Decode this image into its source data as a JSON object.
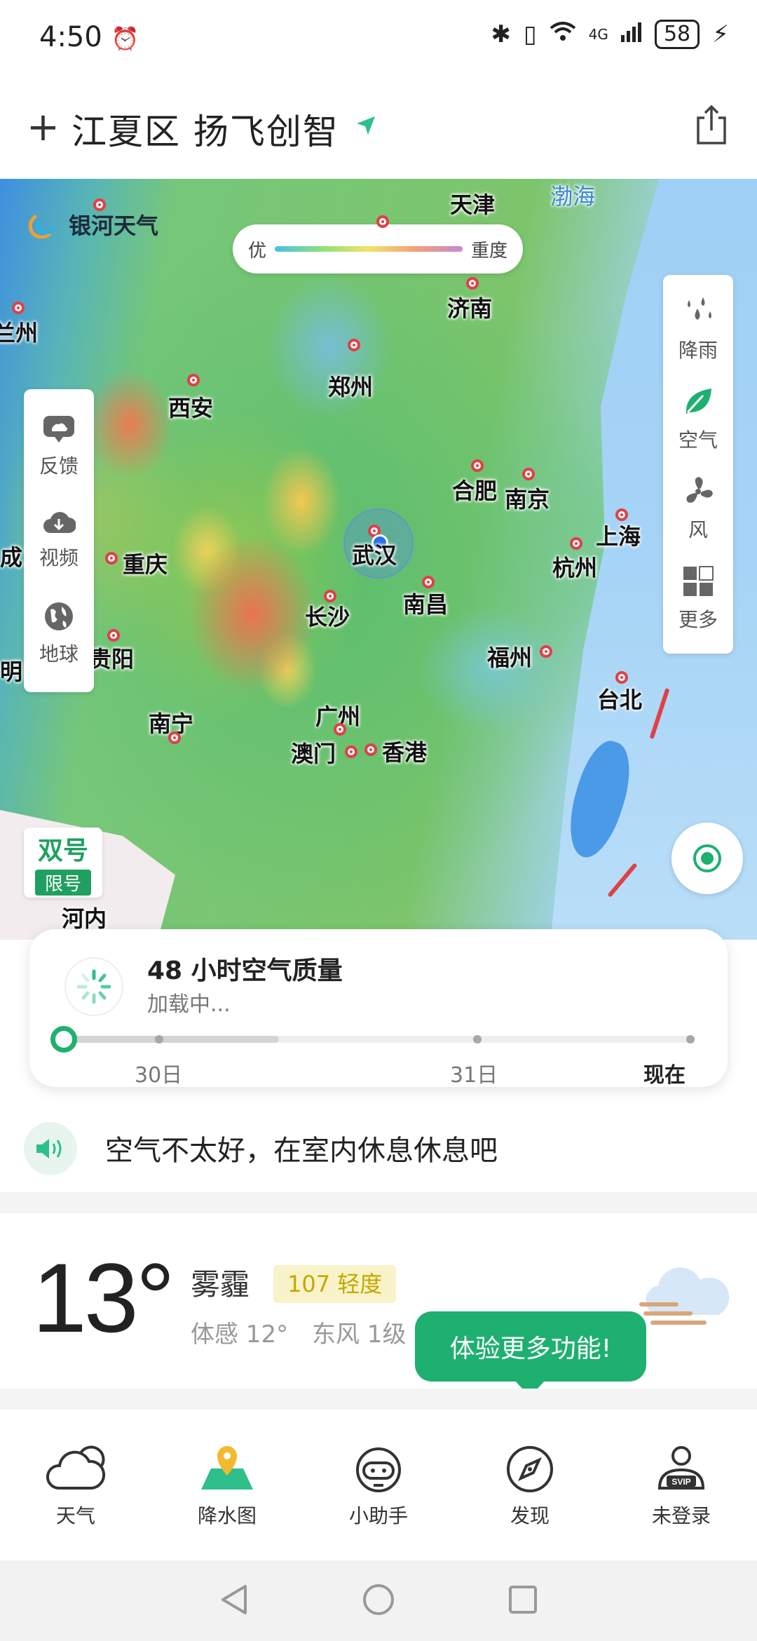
{
  "status_bar": {
    "time": "4:50",
    "network": "4G",
    "battery": "58"
  },
  "header": {
    "location": "江夏区 扬飞创智"
  },
  "map": {
    "brand": "银河天气",
    "legend": {
      "low": "优",
      "high": "重度"
    },
    "left_panel": [
      "反馈",
      "视频",
      "地球"
    ],
    "right_panel": [
      "降雨",
      "空气",
      "风",
      "更多"
    ],
    "cities": {
      "tianjin": "天津",
      "bohai": "渤海",
      "jinan": "济南",
      "lanzhou": "兰州",
      "zhengzhou": "郑州",
      "xian": "西安",
      "hefei": "合肥",
      "nanjing": "南京",
      "shanghai": "上海",
      "hangzhou": "杭州",
      "wuhan": "武汉",
      "chongqing": "重庆",
      "cheng": "成",
      "changsha": "长沙",
      "nanchang": "南昌",
      "guiyang": "贵阳",
      "fuzhou": "福州",
      "taibei": "台北",
      "nanning": "南宁",
      "guangzhou": "广州",
      "aomen": "澳门",
      "xianggang": "香港",
      "henei": "河内",
      "ming": "明"
    },
    "plate": {
      "title": "双号",
      "sub": "限号"
    }
  },
  "aqi_card": {
    "title": "48 小时空气质量",
    "status": "加载中...",
    "labels": [
      "30日",
      "31日",
      "现在"
    ]
  },
  "advice": {
    "text": "空气不太好，在室内休息休息吧"
  },
  "weather": {
    "temp": "13°",
    "condition": "雾霾",
    "aqi": "107 轻度",
    "feels_like": "体感 12°",
    "wind": "东风 1级"
  },
  "tooltip": "体验更多功能!",
  "bottom_nav": [
    "天气",
    "降水图",
    "小助手",
    "发现",
    "未登录"
  ],
  "colors": {
    "accent": "#1eb070",
    "pin": "#e04048",
    "aqi_badge_text": "#c5a800"
  }
}
